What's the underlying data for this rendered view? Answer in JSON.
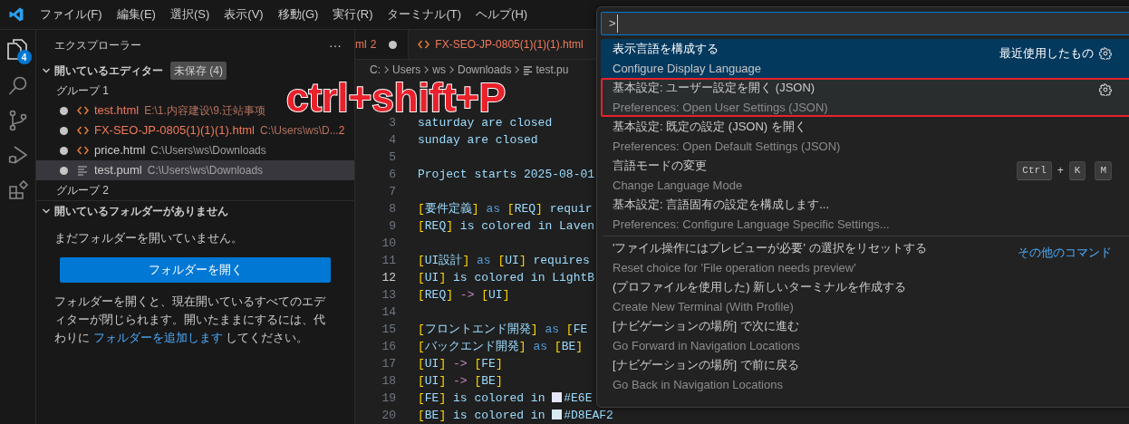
{
  "menu": [
    "ファイル(F)",
    "編集(E)",
    "選択(S)",
    "表示(V)",
    "移動(G)",
    "実行(R)",
    "ターミナル(T)",
    "ヘルプ(H)"
  ],
  "activity_bar": {
    "explorer_badge": "4"
  },
  "sidebar": {
    "title": "エクスプローラー",
    "more": "···",
    "open_editors": {
      "label": "開いているエディター",
      "badge": "未保存 (4)",
      "expanded": true,
      "groups": [
        {
          "label": "グループ 1",
          "items": [
            {
              "name": "test.html",
              "kind": "html",
              "path": "E:\\1.内容建设\\9.迁站事项",
              "modified": true,
              "problem": true,
              "selected": false
            },
            {
              "name": "FX-SEO-JP-0805(1)(1)(1).html",
              "kind": "html",
              "path": "C:\\Users\\ws\\D...",
              "count": "2",
              "modified": true,
              "problem": true,
              "selected": false
            },
            {
              "name": "price.html",
              "kind": "html",
              "path": "C:\\Users\\ws\\Downloads",
              "modified": true,
              "problem": false,
              "selected": false
            },
            {
              "name": "test.puml",
              "kind": "text",
              "path": "C:\\Users\\ws\\Downloads",
              "modified": true,
              "problem": false,
              "selected": true
            }
          ]
        },
        {
          "label": "グループ 2"
        }
      ]
    },
    "folders": {
      "label": "開いているフォルダーがありません",
      "expanded": true,
      "message": "まだフォルダーを開いていません。",
      "button": "フォルダーを開く",
      "note_before": "フォルダーを開くと、現在開いているすべてのエディターが閉じられます。開いたままにするには、代わりに",
      "note_link": "フォルダーを追加します",
      "note_after": "してください。"
    }
  },
  "tabs": [
    {
      "label": "ml",
      "count": "2",
      "modified": true,
      "selected": false
    },
    {
      "label": "FX-SEO-JP-0805(1)(1)(1).html",
      "modified": false,
      "selected": true
    }
  ],
  "breadcrumb": [
    "C:",
    "Users",
    "ws",
    "Downloads",
    "test.pu"
  ],
  "code": [
    {
      "number": "3",
      "tokens": [
        {
          "kind": "text",
          "text": "saturday are closed"
        }
      ]
    },
    {
      "number": "4",
      "tokens": [
        {
          "kind": "text",
          "text": "sunday are closed"
        }
      ]
    },
    {
      "number": "5"
    },
    {
      "number": "6",
      "tokens": [
        {
          "kind": "text",
          "text": "Project starts 2025-08-01"
        }
      ]
    },
    {
      "number": "7"
    },
    {
      "number": "8",
      "tokens": [
        {
          "kind": "bracket",
          "text": "["
        },
        {
          "kind": "text",
          "text": "要件定義"
        },
        {
          "kind": "bracket",
          "text": "]"
        },
        {
          "kind": "keyword",
          "text": " as "
        },
        {
          "kind": "bracket",
          "text": "["
        },
        {
          "kind": "text",
          "text": "REQ"
        },
        {
          "kind": "bracket",
          "text": "]"
        },
        {
          "kind": "text",
          "text": " requir"
        }
      ]
    },
    {
      "number": "9",
      "tokens": [
        {
          "kind": "bracket",
          "text": "["
        },
        {
          "kind": "text",
          "text": "REQ"
        },
        {
          "kind": "bracket",
          "text": "]"
        },
        {
          "kind": "text",
          "text": " is colored in Laven"
        }
      ]
    },
    {
      "number": "10"
    },
    {
      "number": "11",
      "tokens": [
        {
          "kind": "bracket",
          "text": "["
        },
        {
          "kind": "text",
          "text": "UI設計"
        },
        {
          "kind": "bracket",
          "text": "]"
        },
        {
          "kind": "keyword",
          "text": " as "
        },
        {
          "kind": "bracket",
          "text": "["
        },
        {
          "kind": "text",
          "text": "UI"
        },
        {
          "kind": "bracket",
          "text": "]"
        },
        {
          "kind": "text",
          "text": " requires"
        }
      ]
    },
    {
      "number": "12",
      "current": true,
      "tokens": [
        {
          "kind": "bracket",
          "text": "["
        },
        {
          "kind": "text",
          "text": "UI"
        },
        {
          "kind": "bracket",
          "text": "]"
        },
        {
          "kind": "text",
          "text": " is colored in LightB"
        }
      ]
    },
    {
      "number": "13",
      "tokens": [
        {
          "kind": "bracket",
          "text": "["
        },
        {
          "kind": "text",
          "text": "REQ"
        },
        {
          "kind": "bracket",
          "text": "]"
        },
        {
          "kind": "operator",
          "text": " -> "
        },
        {
          "kind": "bracket",
          "text": "["
        },
        {
          "kind": "text",
          "text": "UI"
        },
        {
          "kind": "bracket",
          "text": "]"
        }
      ]
    },
    {
      "number": "14"
    },
    {
      "number": "15",
      "tokens": [
        {
          "kind": "bracket",
          "text": "["
        },
        {
          "kind": "text",
          "text": "フロントエンド開発"
        },
        {
          "kind": "bracket",
          "text": "]"
        },
        {
          "kind": "keyword",
          "text": " as "
        },
        {
          "kind": "bracket",
          "text": "["
        },
        {
          "kind": "text",
          "text": "FE"
        }
      ]
    },
    {
      "number": "16",
      "tokens": [
        {
          "kind": "bracket",
          "text": "["
        },
        {
          "kind": "text",
          "text": "バックエンド開発"
        },
        {
          "kind": "bracket",
          "text": "]"
        },
        {
          "kind": "keyword",
          "text": " as "
        },
        {
          "kind": "bracket",
          "text": "["
        },
        {
          "kind": "text",
          "text": "BE"
        },
        {
          "kind": "bracket",
          "text": "]"
        }
      ]
    },
    {
      "number": "17",
      "tokens": [
        {
          "kind": "bracket",
          "text": "["
        },
        {
          "kind": "text",
          "text": "UI"
        },
        {
          "kind": "bracket",
          "text": "]"
        },
        {
          "kind": "operator",
          "text": " -> "
        },
        {
          "kind": "bracket",
          "text": "["
        },
        {
          "kind": "text",
          "text": "FE"
        },
        {
          "kind": "bracket",
          "text": "]"
        }
      ]
    },
    {
      "number": "18",
      "tokens": [
        {
          "kind": "bracket",
          "text": "["
        },
        {
          "kind": "text",
          "text": "UI"
        },
        {
          "kind": "bracket",
          "text": "]"
        },
        {
          "kind": "operator",
          "text": " -> "
        },
        {
          "kind": "bracket",
          "text": "["
        },
        {
          "kind": "text",
          "text": "BE"
        },
        {
          "kind": "bracket",
          "text": "]"
        }
      ]
    },
    {
      "number": "19",
      "tokens": [
        {
          "kind": "bracket",
          "text": "["
        },
        {
          "kind": "text",
          "text": "FE"
        },
        {
          "kind": "bracket",
          "text": "]"
        },
        {
          "kind": "text",
          "text": " is colored in "
        },
        {
          "kind": "swatch",
          "color": "#e6e6fa"
        },
        {
          "kind": "text",
          "text": "#E6E"
        }
      ]
    },
    {
      "number": "20",
      "tokens": [
        {
          "kind": "bracket",
          "text": "["
        },
        {
          "kind": "text",
          "text": "BE"
        },
        {
          "kind": "bracket",
          "text": "]"
        },
        {
          "kind": "text",
          "text": " is colored in "
        },
        {
          "kind": "swatch",
          "color": "#d8eaf2"
        },
        {
          "kind": "text",
          "text": "#D8EAF2"
        }
      ]
    }
  ],
  "annotation": "ctrl+shift+P",
  "palette": {
    "input": ">",
    "items": [
      {
        "title": "表示言語を構成する",
        "subtitle": "Configure Display Language",
        "selected": true,
        "highlighted": false,
        "gear": true,
        "right_label": "最近使用したもの"
      },
      {
        "title": "基本設定: ユーザー設定を開く (JSON)",
        "subtitle": "Preferences: Open User Settings (JSON)",
        "selected": false,
        "highlighted": true,
        "gear": true
      },
      {
        "title": "基本設定: 既定の設定 (JSON) を開く",
        "subtitle": "Preferences: Open Default Settings (JSON)",
        "selected": false,
        "highlighted": false
      },
      {
        "title": "言語モードの変更",
        "subtitle": "Change Language Mode",
        "selected": false,
        "highlighted": false,
        "keys": [
          "Ctrl",
          "+",
          "K",
          "M"
        ]
      },
      {
        "title": "基本設定: 言語固有の設定を構成します...",
        "subtitle": "Preferences: Configure Language Specific Settings...",
        "selected": false,
        "highlighted": false
      },
      {
        "title": "'ファイル操作にはプレビューが必要' の選択をリセットする",
        "subtitle": "Reset choice for 'File operation needs preview'",
        "selected": false,
        "highlighted": false,
        "separator": true,
        "right_link": "その他のコマンド"
      },
      {
        "title": "(プロファイルを使用した) 新しいターミナルを作成する",
        "subtitle": "Create New Terminal (With Profile)",
        "selected": false,
        "highlighted": false
      },
      {
        "title": "[ナビゲーションの場所] で次に進む",
        "subtitle": "Go Forward in Navigation Locations",
        "selected": false,
        "highlighted": false
      },
      {
        "title": "[ナビゲーションの場所] で前に戻る",
        "subtitle": "Go Back in Navigation Locations",
        "selected": false,
        "highlighted": false
      }
    ]
  }
}
